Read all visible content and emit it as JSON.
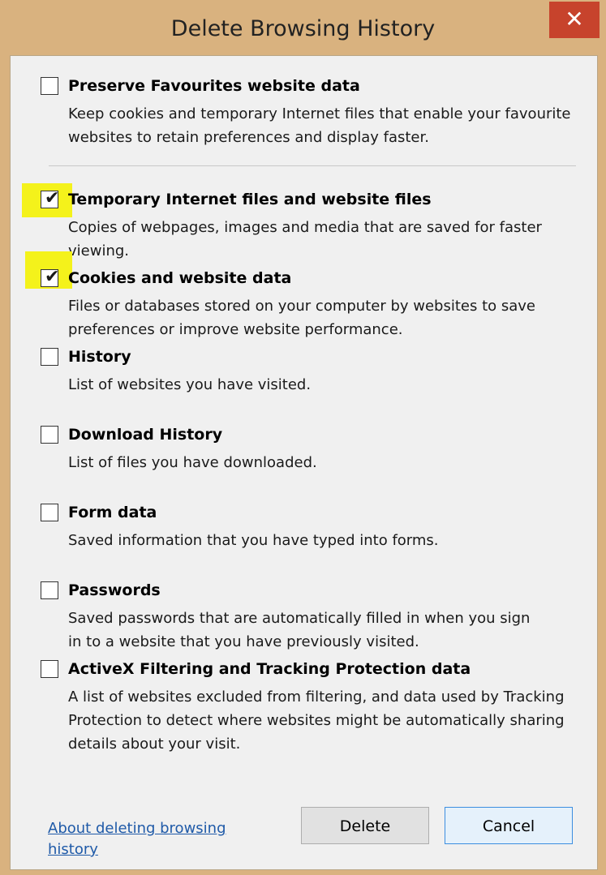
{
  "window": {
    "title": "Delete Browsing History",
    "close_glyph": "✕"
  },
  "options": [
    {
      "label": "Preserve Favourites website data",
      "description": "Keep cookies and temporary Internet files that enable your favourite websites to retain preferences and display faster.",
      "checked": false
    },
    {
      "label": "Temporary Internet files and website files",
      "description": "Copies of webpages, images and media that are saved for faster viewing.",
      "checked": true
    },
    {
      "label": "Cookies and website data",
      "description": "Files or databases stored on your computer by websites to save preferences or improve website performance.",
      "checked": true
    },
    {
      "label": "History",
      "description": "List of websites you have visited.",
      "checked": false
    },
    {
      "label": "Download History",
      "description": "List of files you have downloaded.",
      "checked": false
    },
    {
      "label": "Form data",
      "description": "Saved information that you have typed into forms.",
      "checked": false
    },
    {
      "label": "Passwords",
      "description": "Saved passwords that are automatically filled in when you sign in to a website that you have previously visited.",
      "checked": false
    },
    {
      "label": "ActiveX Filtering and Tracking Protection data",
      "description": "A list of websites excluded from filtering, and data used by Tracking Protection to detect where websites might be automatically sharing details about your visit.",
      "checked": false
    }
  ],
  "footer": {
    "about_link": "About deleting browsing history",
    "delete_label": "Delete",
    "cancel_label": "Cancel"
  },
  "colors": {
    "title_bar": "#d9b27f",
    "close_button": "#c7432c",
    "highlight": "#f4f21b",
    "link": "#1f5aa8"
  },
  "icons": {
    "close": "close-icon",
    "check": "checkmark-icon"
  }
}
